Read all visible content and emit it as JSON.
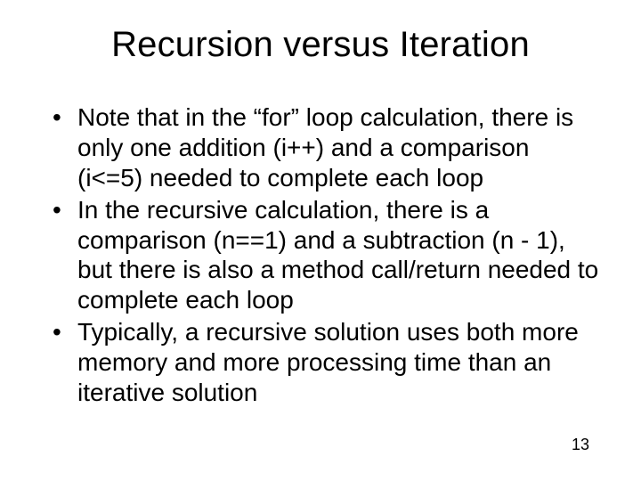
{
  "slide": {
    "title": "Recursion versus Iteration",
    "bullets": [
      "Note that in the “for” loop calculation, there is only one addition (i++) and a comparison (i<=5) needed to complete each loop",
      "In the recursive calculation, there is a comparison (n==1) and a subtraction (n - 1), but there is also a method call/return needed to complete each loop",
      "Typically, a recursive solution uses both more memory and more processing time than an iterative solution"
    ],
    "page_number": "13"
  }
}
